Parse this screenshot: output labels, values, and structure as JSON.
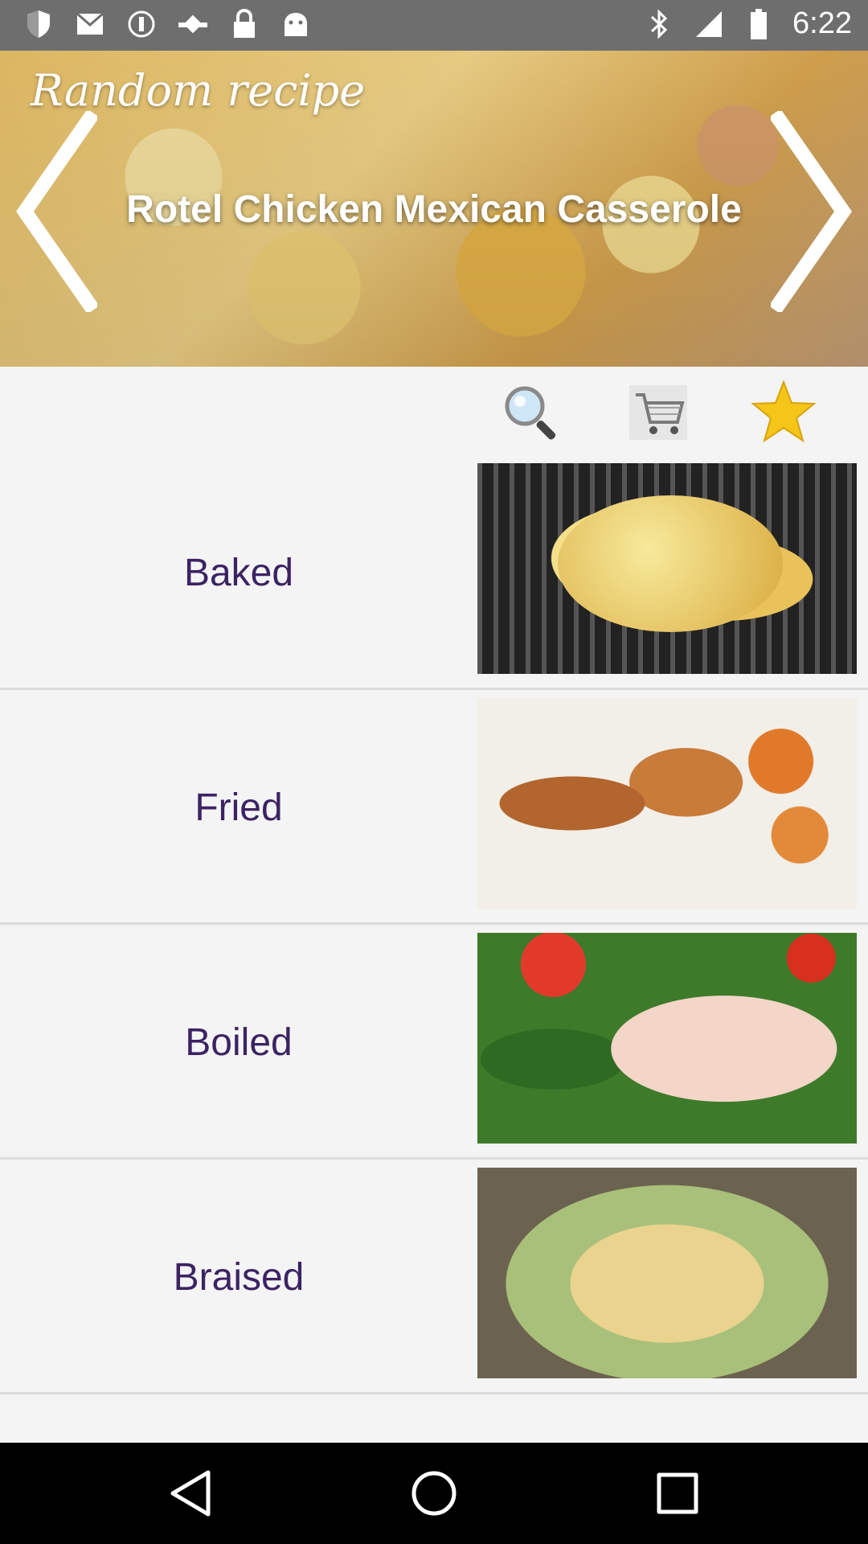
{
  "status_bar": {
    "time": "6:22",
    "left_icons": [
      "shield-icon",
      "mail-icon",
      "info-icon",
      "fake-gps-icon",
      "lock-icon",
      "android-icon"
    ],
    "right_icons": [
      "bluetooth-icon",
      "signal-icon",
      "battery-icon"
    ]
  },
  "hero": {
    "label": "Random recipe",
    "title": "Rotel Chicken Mexican Casserole"
  },
  "toolbar": {
    "icons": [
      "search-icon",
      "cart-icon",
      "star-icon"
    ]
  },
  "categories": [
    {
      "label": "Baked"
    },
    {
      "label": "Fried"
    },
    {
      "label": "Boiled"
    },
    {
      "label": "Braised"
    }
  ],
  "colors": {
    "status_bar": "#6e6e6e",
    "category_text": "#3b2363",
    "star": "#f5c518"
  }
}
